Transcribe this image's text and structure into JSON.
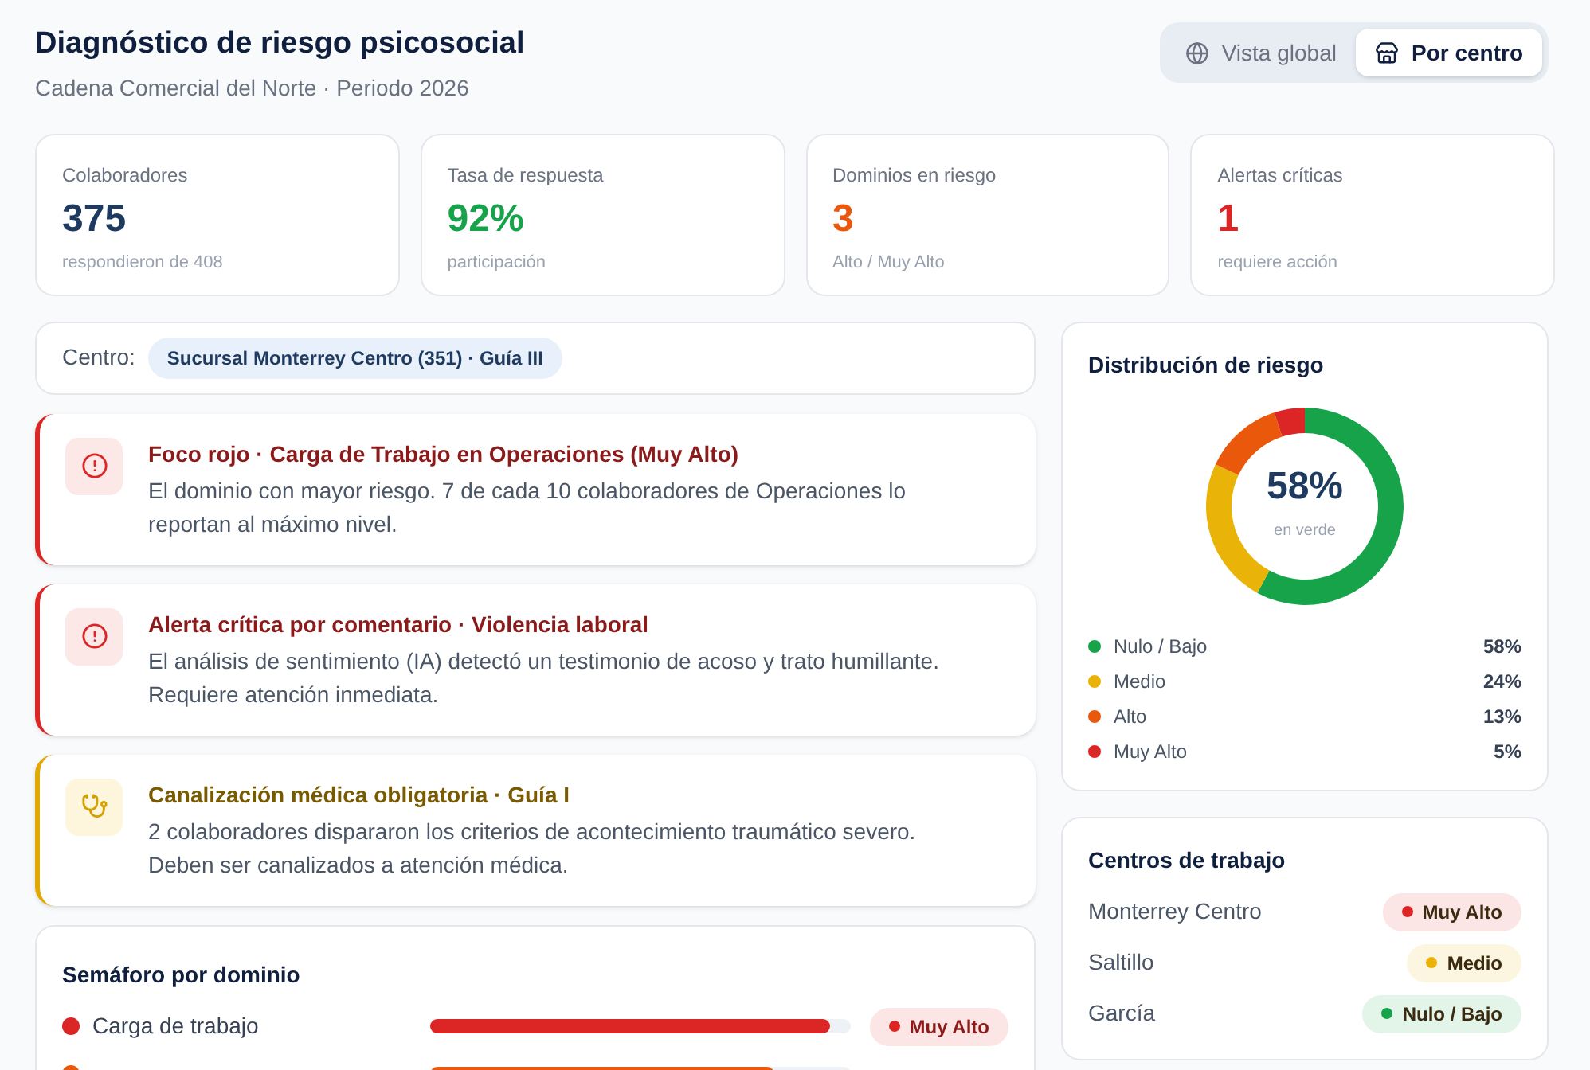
{
  "header": {
    "title": "Diagnóstico de riesgo psicosocial",
    "subtitle": "Cadena Comercial del Norte · Periodo 2026"
  },
  "view_toggle": [
    {
      "label": "Vista global",
      "selected": false
    },
    {
      "label": "Por centro",
      "selected": true
    }
  ],
  "stats": [
    {
      "label": "Colaboradores",
      "value": "375",
      "note": "respondieron de 408",
      "color": "#1e3a5f"
    },
    {
      "label": "Tasa de respuesta",
      "value": "92%",
      "note": "participación",
      "color": "#16a34a"
    },
    {
      "label": "Dominios en riesgo",
      "value": "3",
      "note": "Alto / Muy Alto",
      "color": "#ea580c"
    },
    {
      "label": "Alertas críticas",
      "value": "1",
      "note": "requiere acción",
      "color": "#dc2626"
    }
  ],
  "center_filter": {
    "label": "Centro:",
    "value": "Sucursal Monterrey Centro (351) · Guía III"
  },
  "alerts": [
    {
      "kind": "danger",
      "title": "Foco rojo · Carga de Trabajo en Operaciones (Muy Alto)",
      "text": "El dominio con mayor riesgo. 7 de cada 10 colaboradores de Operaciones lo reportan al máximo nivel."
    },
    {
      "kind": "danger",
      "title": "Alerta crítica por comentario · Violencia laboral",
      "text": "El análisis de sentimiento (IA) detectó un testimonio de acoso y trato humillante. Requiere atención inmediata."
    },
    {
      "kind": "medical",
      "title": "Canalización médica obligatoria · Guía I",
      "text": "2 colaboradores dispararon los criterios de acontecimiento traumático severo. Deben ser canalizados a atención médica."
    }
  ],
  "domains": {
    "title": "Semáforo por dominio",
    "rows": [
      {
        "label": "Carga de trabajo",
        "level": 0.95,
        "color": "#dc2626",
        "badge": "Muy Alto"
      },
      {
        "level": 0.82,
        "color": "#ea580c"
      }
    ]
  },
  "distribution": {
    "title": "Distribución de riesgo",
    "center_value": "58%",
    "center_label": "en verde",
    "slice_colors": [
      {
        "color": "#16a34a"
      },
      {
        "color": "#eab308"
      },
      {
        "color": "#ea580c"
      },
      {
        "color": "#dc2626"
      }
    ],
    "chart_data": {
      "type": "donut",
      "categories": [
        "Nulo / Bajo",
        "Medio",
        "Alto",
        "Muy Alto"
      ],
      "series": [
        {
          "values": [
            58,
            24,
            13,
            5
          ]
        }
      ],
      "value_labels": [
        "58%",
        "24%",
        "13%",
        "5%"
      ]
    }
  },
  "centers": {
    "title": "Centros de trabajo",
    "rows": [
      {
        "name": "Monterrey Centro",
        "badge": "Muy Alto",
        "color": "#dc2626"
      },
      {
        "name": "Saltillo",
        "badge": "Medio",
        "color": "#eab308"
      },
      {
        "name": "García",
        "badge": "Nulo / Bajo",
        "color": "#16a34a"
      }
    ]
  }
}
